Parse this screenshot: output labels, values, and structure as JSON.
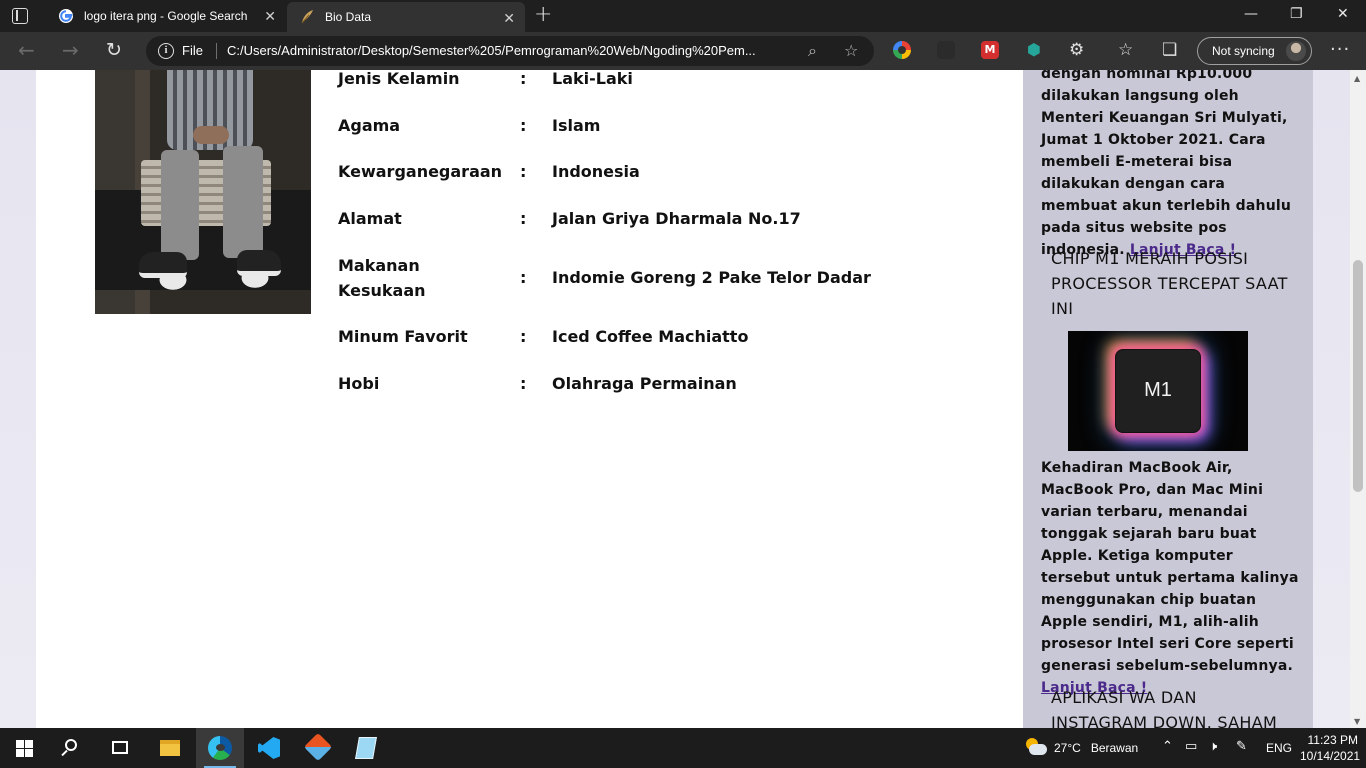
{
  "browser": {
    "tabs": [
      {
        "title": "logo itera png - Google Search",
        "favicon": "google-icon",
        "active": false
      },
      {
        "title": "Bio Data",
        "favicon": "feather-icon",
        "active": true
      }
    ],
    "address": {
      "scheme": "File",
      "url": "C:/Users/Administrator/Desktop/Semester%205/Pemrograman%20Web/Ngoding%20Pem..."
    },
    "profile_button": "Not syncing"
  },
  "bio": {
    "rows": [
      {
        "label": "Jenis Kelamin",
        "colon": ":",
        "value": "Laki-Laki"
      },
      {
        "label": "Agama",
        "colon": ":",
        "value": "Islam"
      },
      {
        "label": "Kewarganegaraan",
        "colon": ":",
        "value": "Indonesia"
      },
      {
        "label": "Alamat",
        "colon": ":",
        "value": "Jalan Griya Dharmala No.17"
      },
      {
        "label": "Makanan Kesukaan",
        "colon": ":",
        "value": "Indomie Goreng 2 Pake Telor Dadar"
      },
      {
        "label": "Minum Favorit",
        "colon": ":",
        "value": "Iced Coffee Machiatto"
      },
      {
        "label": "Hobi",
        "colon": ":",
        "value": "Olahraga Permainan"
      }
    ]
  },
  "sidebar": {
    "news1": {
      "text": "dengan nominal Rp10.000 dilakukan langsung oleh Menteri Keuangan Sri Mulyati, Jumat 1 Oktober 2021. Cara membeli E-meterai bisa dilakukan dengan cara membuat akun terlebih dahulu pada situs website pos indonesia.",
      "link": "Lanjut Baca !"
    },
    "news2": {
      "title": "CHIP M1 MERAIH POSISI PROCESSOR TERCEPAT SAAT INI",
      "image_label": "M1",
      "text": "Kehadiran MacBook Air, MacBook Pro, dan Mac Mini varian terbaru, menandai tonggak sejarah baru buat Apple. Ketiga komputer tersebut untuk pertama kalinya menggunakan chip buatan Apple sendiri, M1, alih-alih prosesor Intel seri Core seperti generasi sebelum-sebelumnya.",
      "link": "Lanjut Baca !"
    },
    "news3": {
      "title": "APLIKASI WA DAN INSTAGRAM DOWN, SAHAM"
    }
  },
  "taskbar": {
    "weather": {
      "temp": "27°C",
      "desc": "Berawan"
    },
    "language": "ENG",
    "time": "11:23 PM",
    "date": "10/14/2021"
  },
  "colors": {
    "link": "#4b2a8c",
    "sidebar_bg": "#c9c8d6",
    "chrome_dark": "#1f1f1f"
  }
}
